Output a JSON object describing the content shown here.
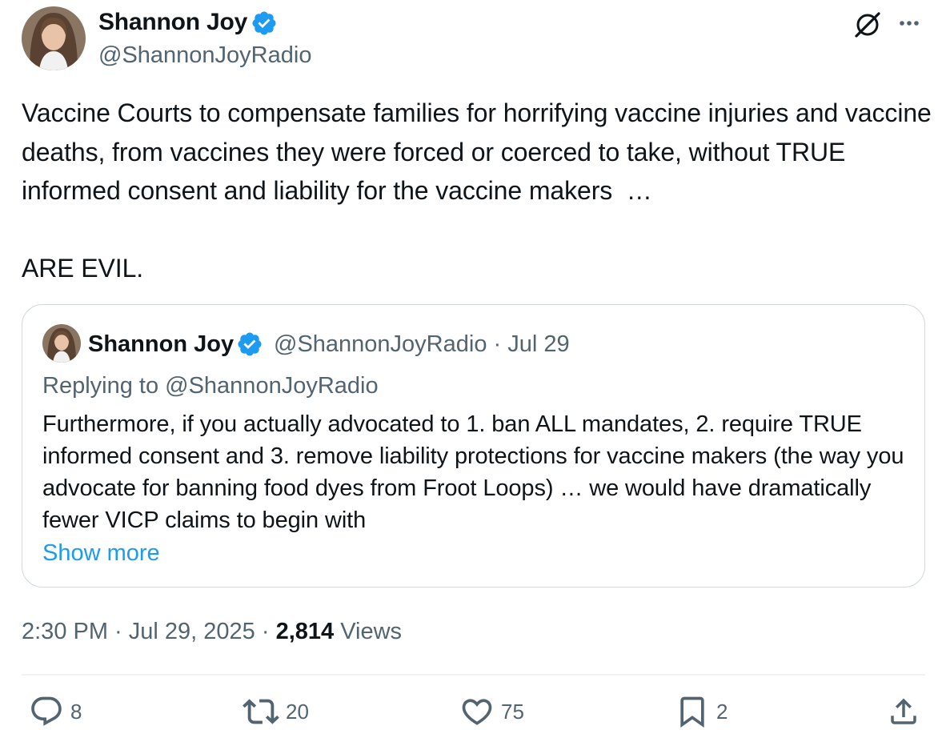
{
  "author": {
    "name": "Shannon Joy",
    "handle": "@ShannonJoyRadio",
    "verified": true
  },
  "tweet": {
    "text": "Vaccine Courts to compensate families for horrifying vaccine injuries and vaccine deaths, from vaccines they were forced or coerced to take, without TRUE informed consent and liability for the vaccine makers  …\n\nARE EVIL."
  },
  "quote": {
    "name": "Shannon Joy",
    "handle_date": "@ShannonJoyRadio · Jul 29",
    "replying_to": "Replying to @ShannonJoyRadio",
    "text": "Furthermore, if you actually advocated to 1. ban ALL mandates, 2. require TRUE informed consent and 3. remove liability protections for vaccine makers (the way you advocate for banning food dyes from Froot Loops) … we would have dramatically fewer VICP claims to begin with",
    "show_more": "Show more"
  },
  "meta": {
    "time_date": "2:30 PM · Jul 29, 2025 · ",
    "views_count": "2,814",
    "views_label": " Views"
  },
  "actions": {
    "replies": "8",
    "reposts": "20",
    "likes": "75",
    "bookmarks": "2"
  },
  "colors": {
    "text": "#0f1419",
    "secondary": "#536471",
    "accent": "#1d9bf0",
    "border": "#cfd9de"
  },
  "icons": [
    "grok-icon",
    "more-icon",
    "verified-icon",
    "reply-icon",
    "repost-icon",
    "like-icon",
    "bookmark-icon",
    "share-icon"
  ]
}
